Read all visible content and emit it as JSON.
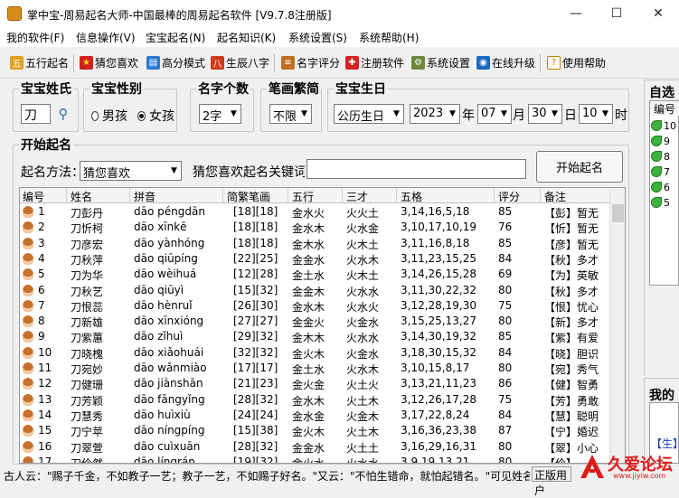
{
  "window": {
    "title": "掌中宝-周易起名大师-中国最棒的周易起名软件 [V9.7.8注册版]"
  },
  "menu": [
    "我的软件(F)",
    "信息操作(V)",
    "宝宝起名(N)",
    "起名知识(K)",
    "系统设置(S)",
    "系统帮助(H)"
  ],
  "toolbar": [
    {
      "label": "五行起名",
      "icon": "five-elements-icon",
      "color": "#e0a020",
      "glyph": "五"
    },
    {
      "label": "猜您喜欢",
      "icon": "star-icon",
      "color": "#d02020",
      "glyph": "★"
    },
    {
      "label": "高分模式",
      "icon": "chart-icon",
      "color": "#2a7bd0",
      "glyph": "▤"
    },
    {
      "label": "生辰八字",
      "icon": "calendar-icon",
      "color": "#d03a1a",
      "glyph": "八"
    },
    {
      "label": "名字评分",
      "icon": "book-icon",
      "color": "#c07020",
      "glyph": "≡"
    },
    {
      "label": "注册软件",
      "icon": "gift-icon",
      "color": "#d82020",
      "glyph": "✚"
    },
    {
      "label": "系统设置",
      "icon": "settings-icon",
      "color": "#6a8a3a",
      "glyph": "⚙"
    },
    {
      "label": "在线升级",
      "icon": "globe-icon",
      "color": "#1a6ac0",
      "glyph": "◉"
    },
    {
      "label": "使用帮助",
      "icon": "help-icon",
      "color": "#d0a020",
      "glyph": "?"
    }
  ],
  "form": {
    "surname_label": "宝宝姓氏",
    "surname_value": "刀",
    "gender_label": "宝宝性别",
    "gender_male": "男孩",
    "gender_female": "女孩",
    "count_label": "名字个数",
    "count_value": "2字",
    "strokes_label": "笔画繁简",
    "strokes_value": "不限",
    "birthday_label": "宝宝生日",
    "calendar_value": "公历生日",
    "year": "2023",
    "year_unit": "年",
    "month": "07",
    "month_unit": "月",
    "day": "30",
    "day_unit": "日",
    "hour": "10",
    "hour_unit": "时"
  },
  "start": {
    "section_label": "开始起名",
    "method_label": "起名方法：",
    "method_value": "猜您喜欢",
    "keyword_label": "猜您喜欢起名关键词：",
    "keyword_value": "",
    "button_label": "开始起名"
  },
  "table": {
    "columns": [
      "编号",
      "姓名",
      "拼音",
      "简繁笔画",
      "五行",
      "三才",
      "五格",
      "评分",
      "备注"
    ],
    "rows": [
      [
        "1",
        "刀彭丹",
        "dāo péngdān",
        "[18][18]",
        "金水火",
        "火火土",
        "3,14,16,5,18",
        "85",
        "【彭】暂无"
      ],
      [
        "2",
        "刀忻柯",
        "dāo xīnkē",
        "[18][18]",
        "金水木",
        "火水金",
        "3,10,17,10,19",
        "76",
        "【忻】暂无"
      ],
      [
        "3",
        "刀彦宏",
        "dāo yànhóng",
        "[18][18]",
        "金木水",
        "火木土",
        "3,11,16,8,18",
        "85",
        "【彦】暂无"
      ],
      [
        "4",
        "刀秋萍",
        "dāo qiūpíng",
        "[22][25]",
        "金金水",
        "火水木",
        "3,11,23,15,25",
        "84",
        "【秋】多才"
      ],
      [
        "5",
        "刀为华",
        "dāo wèihuá",
        "[12][28]",
        "金土水",
        "火木土",
        "3,14,26,15,28",
        "69",
        "【为】英敏"
      ],
      [
        "6",
        "刀秋艺",
        "dāo qiūyì",
        "[15][32]",
        "金金木",
        "火水水",
        "3,11,30,22,32",
        "80",
        "【秋】多才"
      ],
      [
        "7",
        "刀恨蕊",
        "dāo hènruǐ",
        "[26][30]",
        "金水木",
        "火水火",
        "3,12,28,19,30",
        "75",
        "【恨】忧心"
      ],
      [
        "8",
        "刀新雄",
        "dāo xīnxióng",
        "[27][27]",
        "金金火",
        "火金水",
        "3,15,25,13,27",
        "80",
        "【新】多才"
      ],
      [
        "9",
        "刀紫蕙",
        "dāo zǐhuì",
        "[29][32]",
        "金木木",
        "火水水",
        "3,14,30,19,32",
        "85",
        "【紫】有爱"
      ],
      [
        "10",
        "刀晓槐",
        "dāo xiǎohuái",
        "[32][32]",
        "金火木",
        "火金水",
        "3,18,30,15,32",
        "84",
        "【晓】胆识"
      ],
      [
        "11",
        "刀宛妙",
        "dāo wǎnmiào",
        "[17][17]",
        "金土水",
        "火水木",
        "3,10,15,8,17",
        "80",
        "【宛】秀气"
      ],
      [
        "12",
        "刀健珊",
        "dāo jiànshān",
        "[21][23]",
        "金火金",
        "火土火",
        "3,13,21,11,23",
        "86",
        "【健】智勇"
      ],
      [
        "13",
        "刀芳颖",
        "dāo fāngyǐng",
        "[28][32]",
        "金水木",
        "火土木",
        "3,12,26,17,28",
        "75",
        "【芳】勇敢"
      ],
      [
        "14",
        "刀慧秀",
        "dāo huìxiù",
        "[24][24]",
        "金水金",
        "火金木",
        "3,17,22,8,24",
        "84",
        "【慧】聪明"
      ],
      [
        "15",
        "刀宁苹",
        "dāo níngpíng",
        "[15][38]",
        "金火木",
        "火土木",
        "3,16,36,23,38",
        "87",
        "【宁】婚迟"
      ],
      [
        "16",
        "刀翠萱",
        "dāo cuìxuān",
        "[28][32]",
        "金金水",
        "火土土",
        "3,16,29,16,31",
        "80",
        "【翠】小心"
      ],
      [
        "17",
        "刀伶然",
        "dāo língrán",
        "[19][32]",
        "金火水",
        "火水水",
        "3,9,19,13,21",
        "80",
        "【伶】"
      ]
    ]
  },
  "right_panel": {
    "header": "自选",
    "column": "编号",
    "items": [
      "10",
      "9",
      "8",
      "7",
      "6",
      "5"
    ],
    "lower_header": "我的",
    "lower_text": "【生】"
  },
  "status": {
    "text": "古人云：\"赐子千金，不如教子一艺；教子一艺，不如赐子好名。\"又云：\"不怕生错命，就怕起错名。\"可见姓名",
    "edition": "正版用户"
  },
  "watermark": {
    "text": "久爱论坛",
    "url": "www.jiyiw.com"
  }
}
